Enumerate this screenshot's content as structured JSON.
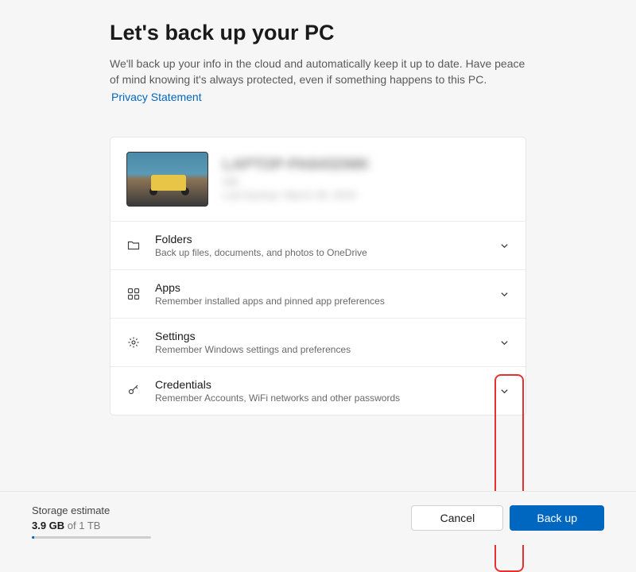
{
  "header": {
    "title": "Let's back up your PC",
    "description": "We'll back up your info in the cloud and automatically keep it up to date. Have peace of mind knowing it's always protected, even if something happens to this PC.",
    "privacy_link": "Privacy Statement"
  },
  "device": {
    "name": "LAPTOP-PA84SDMK",
    "line1": "Idle",
    "line2": "Last backup: March 28, 2024"
  },
  "sections": [
    {
      "icon": "folder-icon",
      "title": "Folders",
      "description": "Back up files, documents, and photos to OneDrive"
    },
    {
      "icon": "apps-icon",
      "title": "Apps",
      "description": "Remember installed apps and pinned app preferences"
    },
    {
      "icon": "settings-icon",
      "title": "Settings",
      "description": "Remember Windows settings and preferences"
    },
    {
      "icon": "credentials-icon",
      "title": "Credentials",
      "description": "Remember Accounts, WiFi networks and other passwords"
    }
  ],
  "footer": {
    "storage_label": "Storage estimate",
    "storage_used": "3.9 GB",
    "storage_total": " of 1 TB",
    "cancel": "Cancel",
    "backup": "Back up"
  }
}
